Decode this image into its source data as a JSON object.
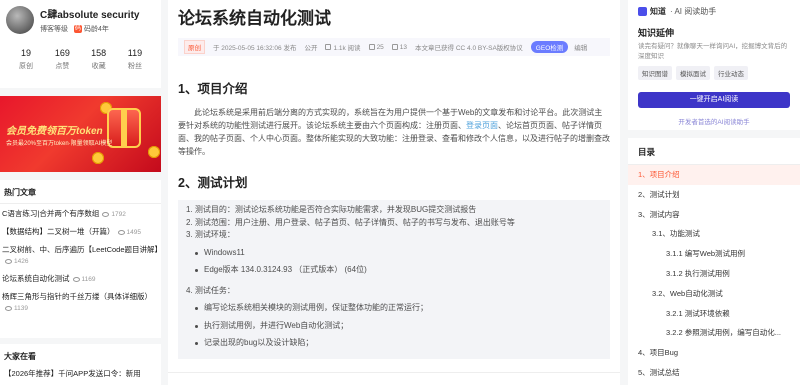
{
  "profile": {
    "username": "C肆absolute security",
    "level": "博客等级",
    "years": "码龄4年",
    "stats": [
      {
        "value": "19",
        "label": "原创"
      },
      {
        "value": "169",
        "label": "点赞"
      },
      {
        "value": "158",
        "label": "收藏"
      },
      {
        "value": "119",
        "label": "粉丝"
      }
    ]
  },
  "banner": {
    "headline": "会员免费领百万token",
    "subline": "会员最20%至百万token·限量领取AI模型"
  },
  "hot_articles": {
    "title": "热门文章",
    "items": [
      {
        "text": "C语言练习|合并两个有序数组",
        "views": "1792"
      },
      {
        "text": "【数据结构】二叉树一堆（开篇）",
        "views": "1495"
      },
      {
        "text": "二叉树前、中、后序遍历【LeetCode题目讲解】",
        "views": "1426"
      },
      {
        "text": "论坛系统自动化测试",
        "views": "1169"
      },
      {
        "text": "杨辉三角形与指针的千丝万缕（具体详细版）",
        "views": "1139"
      }
    ]
  },
  "everyone": {
    "title": "大家在看",
    "items": [
      {
        "text": "【2026年推荐】千问APP发送口令：新用"
      }
    ]
  },
  "article": {
    "title": "论坛系统自动化测试",
    "badge": "原创",
    "published": "于 2025-05-05 16:32:06 发布",
    "visibility": "公开",
    "reads": "1.1k 阅读",
    "likes": "25",
    "favorites": "13",
    "license": "本文章已获得 CC 4.0 BY-SA版权协议",
    "geo": "GEO检测",
    "edit": "编辑",
    "sec1_title": "1、项目介绍",
    "sec1_p1": "此论坛系统是采用前后端分离的方式实现的，系统旨在为用户提供一个基于Web的文章发布和讨论平台。此次测试主要针对系统的功能性测试进行展开。该论坛系统主要由六个页面构成：注册页面、",
    "sec1_link": "登录页面",
    "sec1_p2": "、论坛首页页面、帖子详情页面、我的帖子页面、个人中心页面。整体所能实现的大致功能：注册登录、查看和修改个人信息，以及进行帖子的增删查改等操作。",
    "sec2_title": "2、测试计划",
    "plan": [
      "1.  测试目的：测试论坛系统功能是否符合实际功能需求，并发现BUG提交测试报告",
      "2.  测试范围：用户注册、用户登录、帖子首页、帖子详情页、帖子的书写与发布、退出账号等",
      "3.  测试环境："
    ],
    "env": [
      "Windows11",
      "Edge版本 134.0.3124.93 （正式版本）   (64位)"
    ],
    "task_title": "4.  测试任务：",
    "tasks": [
      "编写论坛系统相关模块的测试用例，保证整体功能的正常运行；",
      "执行测试用例，并进行Web自动化测试；",
      "记录出现的bug以及设计缺陷；"
    ]
  },
  "ai_panel": {
    "brand": "知道",
    "sub": "· AI 阅读助手",
    "title": "知识延伸",
    "desc": "读完有疑问？就像聊天一样询问AI，挖掘博文背后的深度知识",
    "chips": [
      "知识图谱",
      "模拟面试",
      "行业动态"
    ],
    "button": "一键开启AI阅读",
    "footer": "开发者首选的AI阅读助手"
  },
  "toc": {
    "title": "目录",
    "items": [
      {
        "label": "1、项目介绍",
        "level": 1,
        "active": true
      },
      {
        "label": "2、测试计划",
        "level": 1,
        "active": false
      },
      {
        "label": "3、测试内容",
        "level": 1,
        "active": false
      },
      {
        "label": "3.1、功能测试",
        "level": 2,
        "active": false
      },
      {
        "label": "3.1.1 编写Web测试用例",
        "level": 3,
        "active": false
      },
      {
        "label": "3.1.2 执行测试用例",
        "level": 3,
        "active": false
      },
      {
        "label": "3.2、Web自动化测试",
        "level": 2,
        "active": false
      },
      {
        "label": "3.2.1 测试环境依赖",
        "level": 3,
        "active": false
      },
      {
        "label": "3.2.2 参照测试用例，编写自动化...",
        "level": 3,
        "active": false
      },
      {
        "label": "4、项目Bug",
        "level": 1,
        "active": false
      },
      {
        "label": "5、测试总结",
        "level": 1,
        "active": false
      }
    ]
  }
}
